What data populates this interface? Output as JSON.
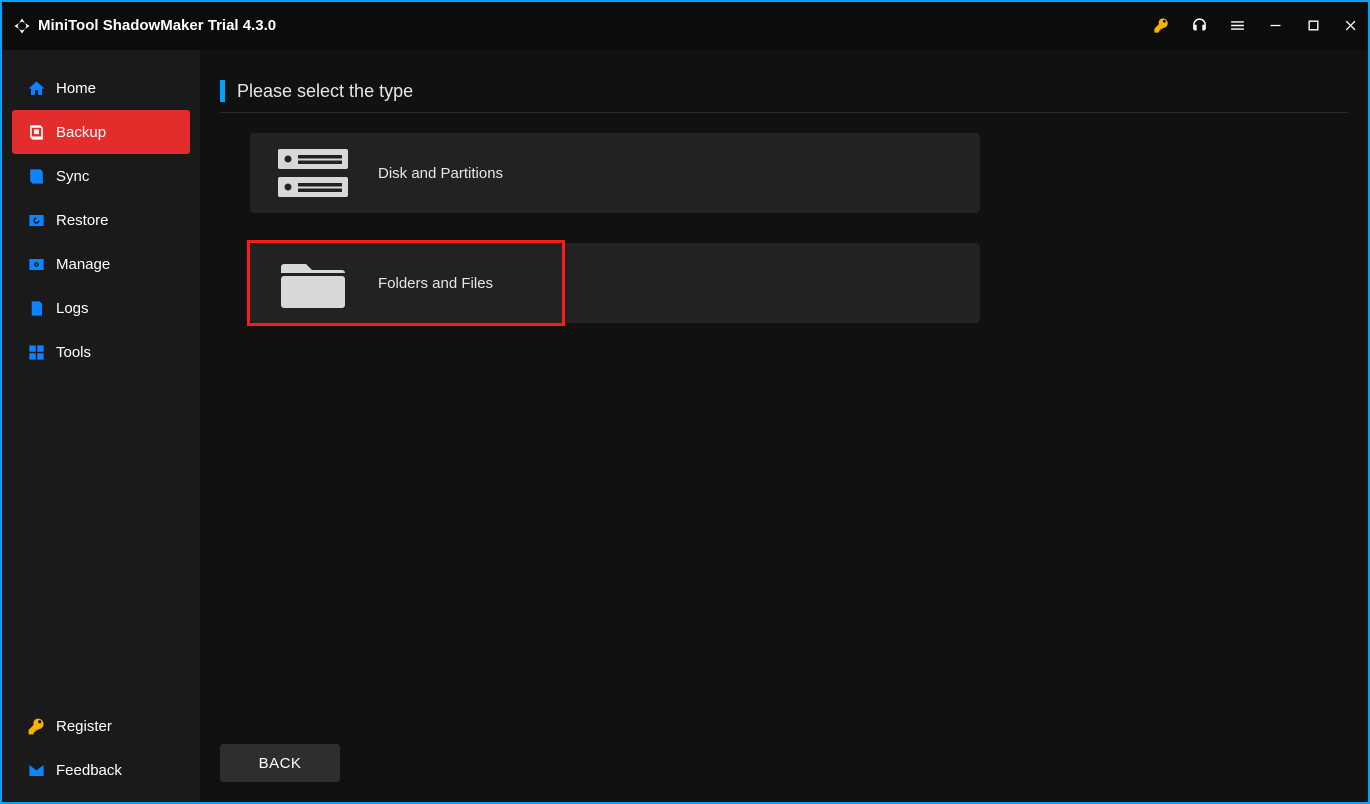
{
  "app_title": "MiniTool ShadowMaker Trial 4.3.0",
  "sidebar": {
    "items": [
      {
        "key": "home",
        "label": "Home",
        "icon": "home-icon",
        "active": false
      },
      {
        "key": "backup",
        "label": "Backup",
        "icon": "backup-icon",
        "active": true
      },
      {
        "key": "sync",
        "label": "Sync",
        "icon": "sync-icon",
        "active": false
      },
      {
        "key": "restore",
        "label": "Restore",
        "icon": "restore-icon",
        "active": false
      },
      {
        "key": "manage",
        "label": "Manage",
        "icon": "manage-icon",
        "active": false
      },
      {
        "key": "logs",
        "label": "Logs",
        "icon": "logs-icon",
        "active": false
      },
      {
        "key": "tools",
        "label": "Tools",
        "icon": "tools-icon",
        "active": false
      }
    ],
    "bottom_items": [
      {
        "key": "register",
        "label": "Register",
        "icon": "key-icon"
      },
      {
        "key": "feedback",
        "label": "Feedback",
        "icon": "mail-icon"
      }
    ]
  },
  "page": {
    "title": "Please select the type",
    "options": [
      {
        "key": "disk",
        "label": "Disk and Partitions",
        "icon": "disk-icon",
        "highlighted": false
      },
      {
        "key": "files",
        "label": "Folders and Files",
        "icon": "folder-icon",
        "highlighted": true
      }
    ],
    "back_label": "BACK"
  },
  "colors": {
    "accent_border": "#00a3ff",
    "sidebar_active": "#e32d2d",
    "highlight_box": "#ff1a1a",
    "icon_blue": "#0a84ff",
    "key_yellow": "#f5b301"
  }
}
